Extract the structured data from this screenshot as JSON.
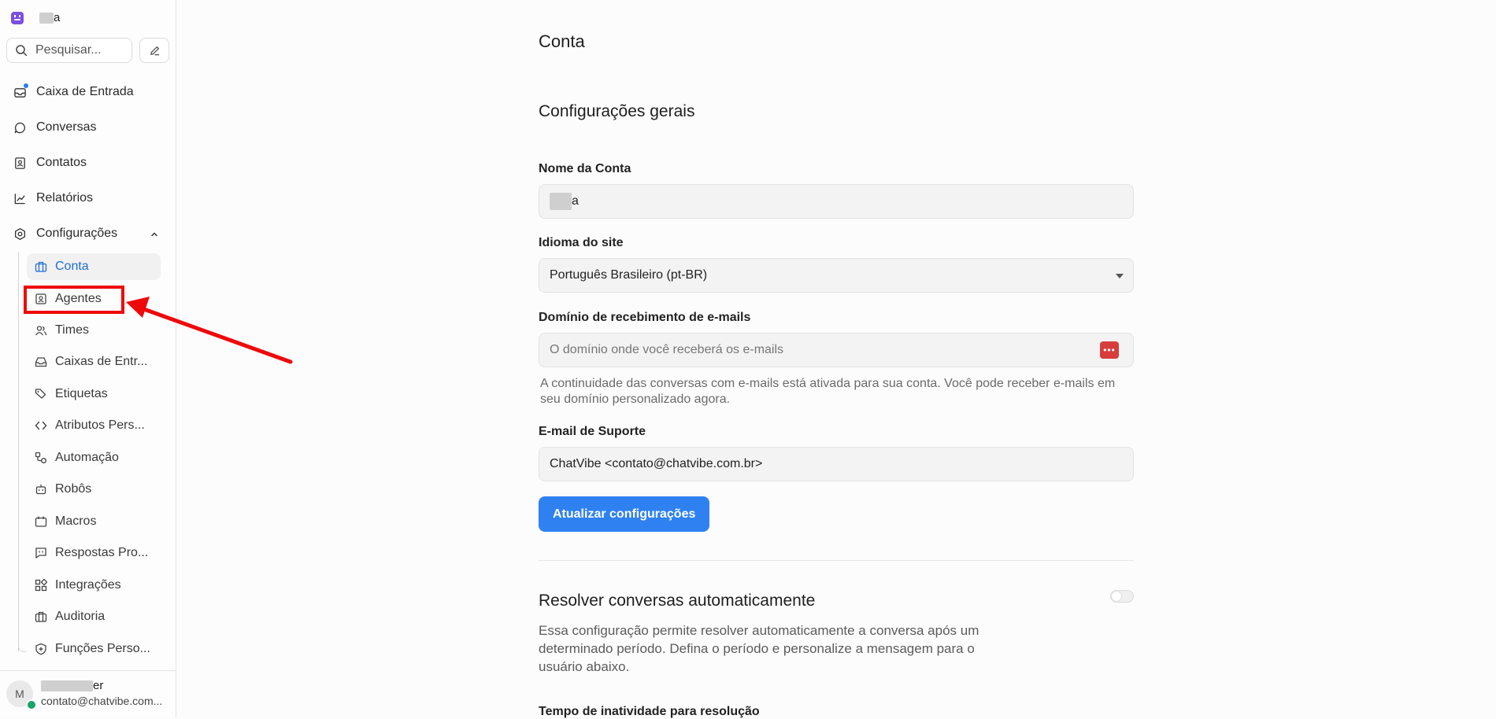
{
  "brand": {
    "name_suffix": "a"
  },
  "search": {
    "placeholder": "Pesquisar..."
  },
  "nav": {
    "inbox": "Caixa de Entrada",
    "conversations": "Conversas",
    "contacts": "Contatos",
    "reports": "Relatórios",
    "settings": "Configurações"
  },
  "settings_menu": {
    "account": "Conta",
    "agents": "Agentes",
    "teams": "Times",
    "inboxes": "Caixas de Entr...",
    "labels": "Etiquetas",
    "attributes": "Atributos Pers...",
    "automation": "Automação",
    "bots": "Robôs",
    "macros": "Macros",
    "canned": "Respostas Pro...",
    "integrations": "Integrações",
    "audit": "Auditoria",
    "roles": "Funções Perso..."
  },
  "user": {
    "avatar_initial": "M",
    "name_suffix": "er",
    "email": "contato@chatvibe.com..."
  },
  "page": {
    "title": "Conta",
    "general_title": "Configurações gerais",
    "account_name_label": "Nome da Conta",
    "account_name_value_suffix": "a",
    "language_label": "Idioma do site",
    "language_value": "Português Brasileiro (pt-BR)",
    "email_domain_label": "Domínio de recebimento de e-mails",
    "email_domain_placeholder": "O domínio onde você receberá os e-mails",
    "email_domain_help": "A continuidade das conversas com e-mails está ativada para sua conta. Você pode receber e-mails em seu domínio personalizado agora.",
    "support_email_label": "E-mail de Suporte",
    "support_email_value": "ChatVibe <contato@chatvibe.com.br>",
    "update_button": "Atualizar configurações",
    "auto_resolve_title": "Resolver conversas automaticamente",
    "auto_resolve_desc": "Essa configuração permite resolver automaticamente a conversa após um determinado período. Defina o período e personalize a mensagem para o usuário abaixo.",
    "inactivity_label": "Tempo de inatividade para resolução"
  },
  "colors": {
    "accent": "#2f81f2",
    "annotation": "#ee0a0a",
    "brand": "#7b4fe0"
  }
}
